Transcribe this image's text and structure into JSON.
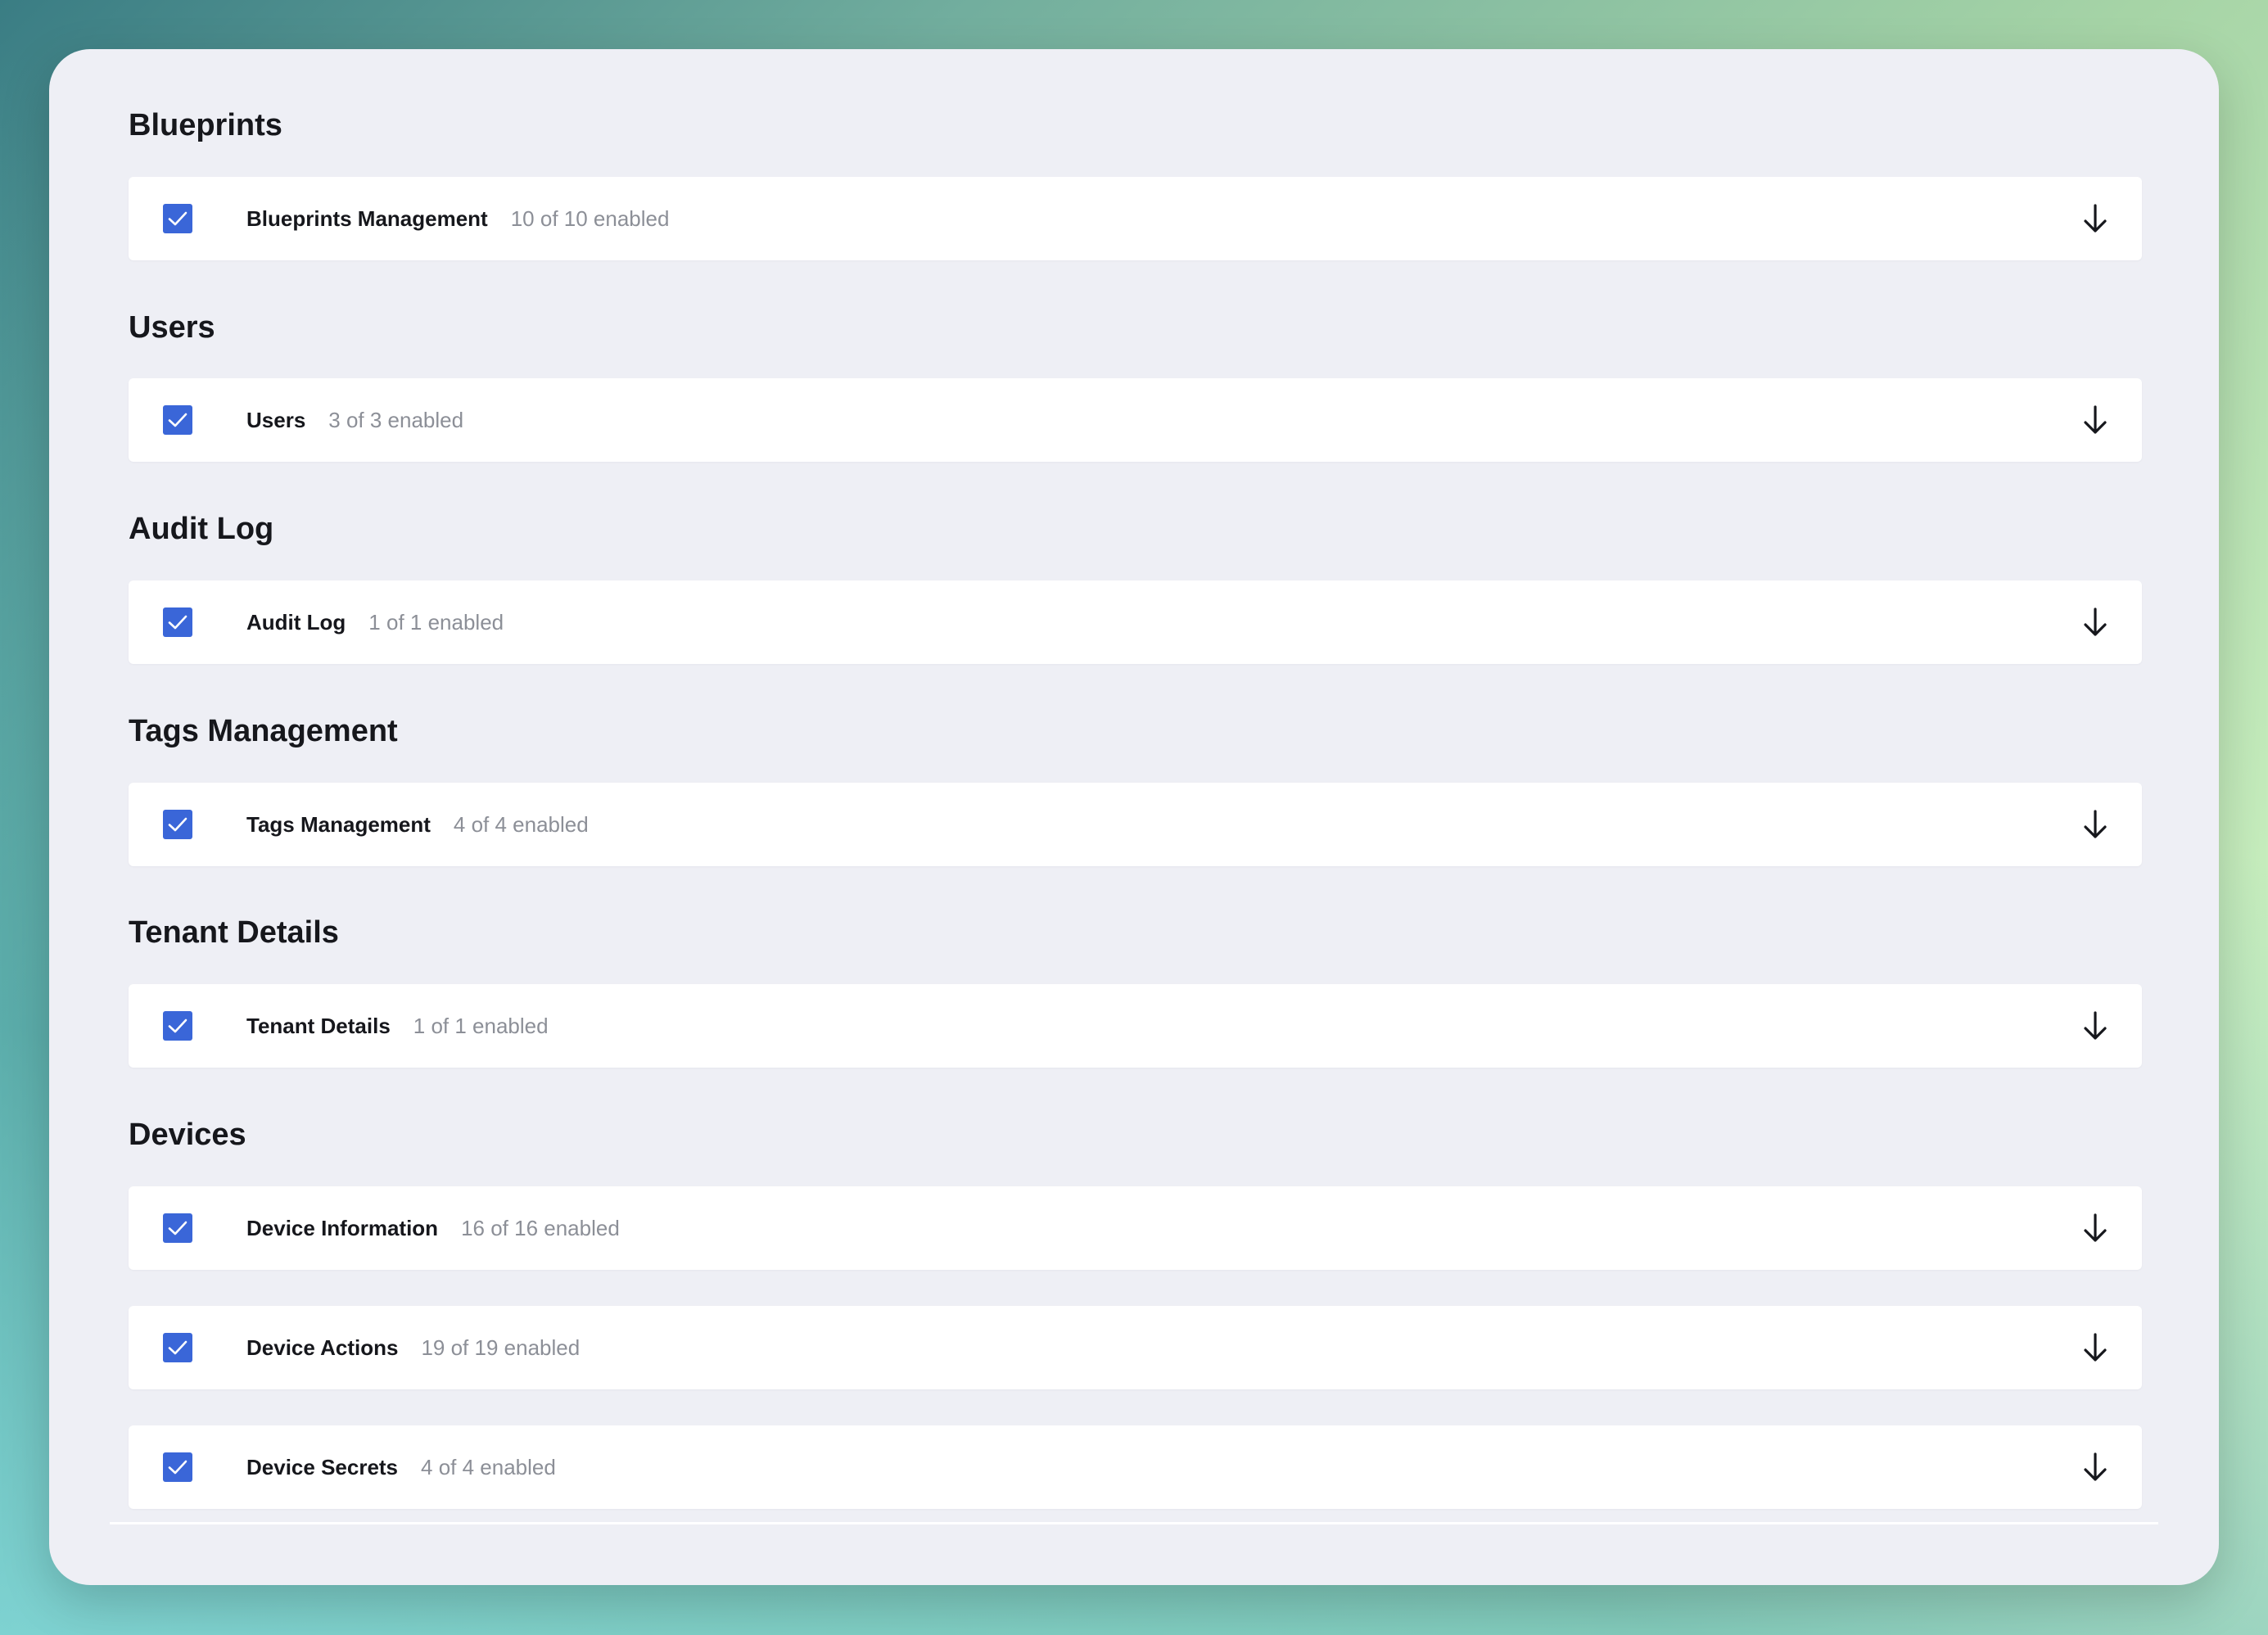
{
  "colors": {
    "panel_bg": "#eeeff5",
    "row_bg": "#ffffff",
    "checkbox_accent": "#3a66d8",
    "title_text": "#16171c",
    "muted_text": "#8c8f97"
  },
  "sections": [
    {
      "title": "Blueprints",
      "rows": [
        {
          "label": "Blueprints Management",
          "count": "10 of 10 enabled",
          "checked": true,
          "icon": "arrow-down-icon"
        }
      ]
    },
    {
      "title": "Users",
      "rows": [
        {
          "label": "Users",
          "count": "3 of 3 enabled",
          "checked": true,
          "icon": "arrow-down-icon"
        }
      ]
    },
    {
      "title": "Audit Log",
      "rows": [
        {
          "label": "Audit Log",
          "count": "1 of 1 enabled",
          "checked": true,
          "icon": "arrow-down-icon"
        }
      ]
    },
    {
      "title": "Tags Management",
      "rows": [
        {
          "label": "Tags Management",
          "count": "4 of 4 enabled",
          "checked": true,
          "icon": "arrow-down-icon"
        }
      ]
    },
    {
      "title": "Tenant Details",
      "rows": [
        {
          "label": "Tenant Details",
          "count": "1 of 1 enabled",
          "checked": true,
          "icon": "arrow-down-icon"
        }
      ]
    },
    {
      "title": "Devices",
      "rows": [
        {
          "label": "Device Information",
          "count": "16 of 16 enabled",
          "checked": true,
          "icon": "arrow-down-icon"
        },
        {
          "label": "Device Actions",
          "count": "19 of 19 enabled",
          "checked": true,
          "icon": "arrow-down-icon"
        },
        {
          "label": "Device Secrets",
          "count": "4 of 4 enabled",
          "checked": true,
          "icon": "arrow-down-icon"
        }
      ]
    }
  ]
}
